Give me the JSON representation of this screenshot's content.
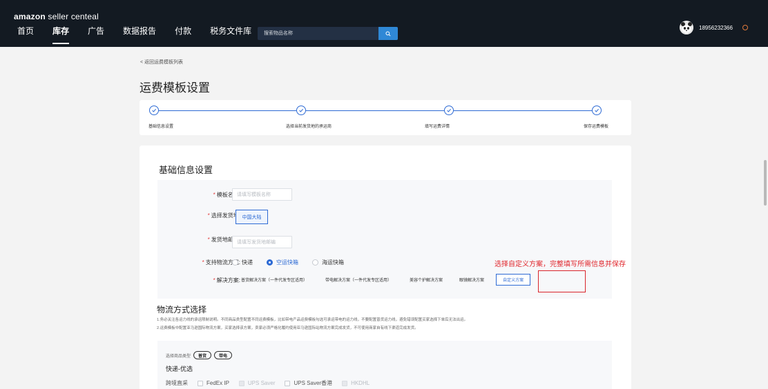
{
  "app": {
    "logo_brand": "amazon",
    "logo_rest": " seller centeal",
    "nav": [
      "首页",
      "库存",
      "广告",
      "数据报告",
      "付款",
      "税务文件库"
    ],
    "active_nav_index": 1,
    "search_placeholder": "搜索物品名称",
    "username": "18956232366"
  },
  "page": {
    "back_link": "< 返回运费模板列表",
    "title": "运费模板设置"
  },
  "steps": [
    "基础信息设置",
    "选择当前发货地的承运商",
    "填写运费详情",
    "保存运费模板"
  ],
  "basic": {
    "title": "基础信息设置",
    "template_name_label": "模板名称:",
    "template_name_placeholder": "请填写模板名称",
    "ship_from_label": "选择发货地:",
    "ship_from_value": "中国大陆",
    "postcode_label": "发货地邮编:",
    "postcode_placeholder": "请填写发货地邮编",
    "method_label": "支持物流方式:",
    "methods": [
      "快递",
      "空运快箱",
      "海运快箱"
    ],
    "method_selected_index": 1,
    "solution_label": "解决方案:",
    "solutions": [
      "普货解决方案（一件代发专区适用）",
      "带电解决方案（一件代发专区适用）",
      "美容个护解决方案",
      "眼镜解决方案",
      "自定义方案"
    ],
    "solution_selected_index": 4,
    "annotation": "选择自定义方案，完整填写所需信息并保存"
  },
  "logistics": {
    "title": "物流方式选择",
    "note1": "1.务必关注各运力线的承运限制说明。不同商品类型配置不同运费模板，比如带电产品运费模板勾选可承运带电的运力线，不要配置普货运力线，避免错误配置买家选择下单后无法出运。",
    "note2": "2.运费模板中配置亚马逊国际物流方案，买家选择该方案，卖家必须严格化履约使用亚马逊国际站物流方案完成发货，不可使用商家自有线下渠道完成发货。",
    "goods_type_label": "选择商品类型",
    "goods_types": [
      "普货",
      "带电"
    ],
    "preferred_title": "快递-优选",
    "carrier_row_label": "跨境直采",
    "carriers": [
      {
        "name": "FedEx IP",
        "disabled": false
      },
      {
        "name": "UPS Saver",
        "disabled": true
      },
      {
        "name": "UPS Saver香港",
        "disabled": false
      },
      {
        "name": "HKDHL",
        "disabled": true
      }
    ]
  },
  "colors": {
    "primary": "#2d6ad4",
    "header_bg": "#131a22",
    "annotation_red": "#e0262c"
  }
}
